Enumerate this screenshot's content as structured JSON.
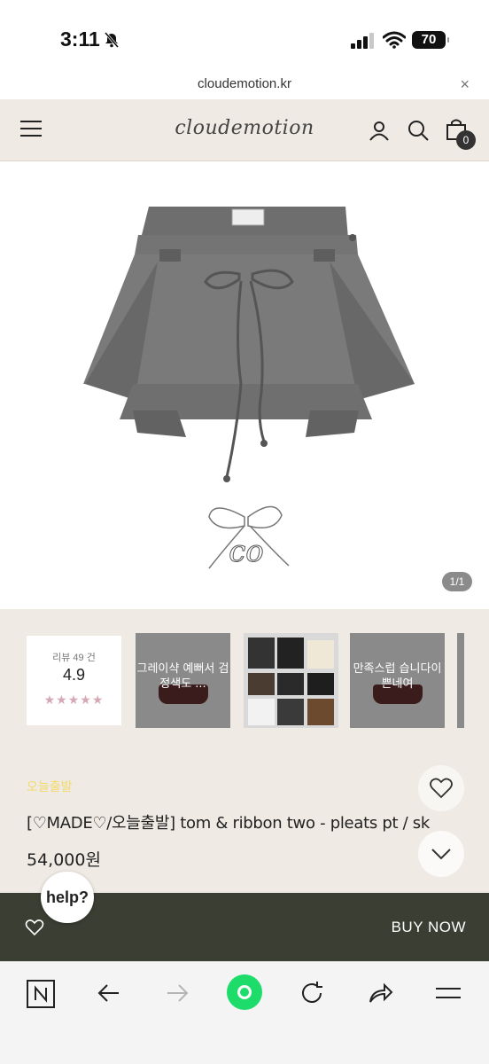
{
  "status_bar": {
    "time": "3:11",
    "battery": "70"
  },
  "browser": {
    "url": "cloudemotion.kr",
    "close": "×"
  },
  "header": {
    "logo": "cloudemotion",
    "cart_count": "0"
  },
  "gallery": {
    "counter": "1/1"
  },
  "reviews": {
    "count_label": "리뷰 49 건",
    "score": "4.9",
    "stars": "★★★★★",
    "thumbnails": [
      {
        "text": "그레이샥 예뻐서 검 정색도 ..."
      },
      {
        "text": ""
      },
      {
        "text": "만족스럽 습니다이 쁜네여"
      }
    ]
  },
  "product": {
    "tag": "오늘출발",
    "title": "[♡MADE♡/오늘출발] tom & ribbon two - pleats pt / sk",
    "price": "54,000원"
  },
  "actions": {
    "buy_now": "BUY NOW",
    "help": "help?"
  },
  "colors": {
    "header_bg": "#efebe4",
    "buy_bar_bg": "#3b3e33",
    "tag_color": "#f2d96b",
    "star_color": "#d4a8b4",
    "green_button": "#1ddc6a"
  }
}
